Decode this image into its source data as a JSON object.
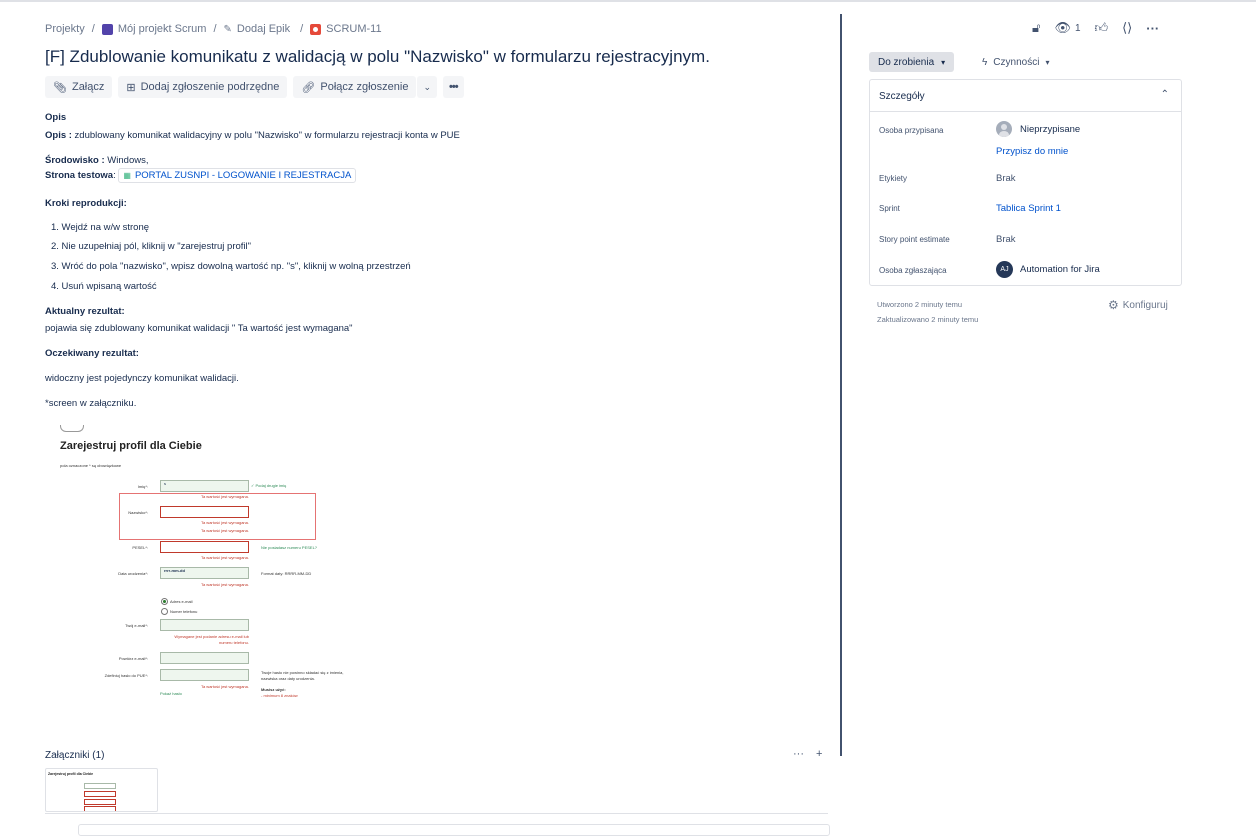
{
  "breadcrumb": {
    "projects": "Projekty",
    "project": "Mój projekt Scrum",
    "epic": "Dodaj Epik",
    "issue_key": "SCRUM-11"
  },
  "issue": {
    "title": "[F] Zdublowanie komunikatu z walidacją w polu \"Nazwisko\" w formularzu rejestracyjnym."
  },
  "toolbar": {
    "attach": "Załącz",
    "add_child": "Dodaj zgłoszenie podrzędne",
    "link_issue": "Połącz zgłoszenie",
    "more": "•••"
  },
  "description": {
    "heading": "Opis",
    "opis_label": "Opis :",
    "opis_text": " zdublowany komunikat walidacyjny w polu \"Nazwisko\" w formularzu rejestracji konta w PUE",
    "env_label": "Środowisko :",
    "env_text": " Windows,",
    "page_label": "Strona testowa",
    "page_link": "PORTAL ZUSNPI - LOGOWANIE I REJESTRACJA",
    "steps_heading": "Kroki reprodukcji:",
    "steps": [
      "1. Wejdź na w/w stronę",
      "2. Nie uzupełniaj pól, kliknij w \"zarejestruj profil\"",
      "3. Wróć do pola \"nazwisko\", wpisz dowolną wartość np. \"s\", kliknij w wolną przestrzeń",
      "4. Usuń wpisaną wartość"
    ],
    "actual_heading": "Aktualny rezultat:",
    "actual_text": "pojawia się zdublowany komunikat walidacji \" Ta wartość jest wymagana\"",
    "expected_heading": "Oczekiwany rezultat:",
    "expected_text": "widoczny jest pojedynczy komunikat walidacji.",
    "screen_note": "*screen w załączniku."
  },
  "screenshot": {
    "title": "Zarejestruj profil dla Ciebie",
    "note": "pola oznaczone * są obowiązkowe",
    "imie": "Imię*:",
    "imie_value": "s",
    "imie_hint": "✓ Podaj drugie imię",
    "req": "Ta wartość jest wymagana.",
    "nazwisko": "Nazwisko*:",
    "pesel": "PESEL*:",
    "pesel_hint": "Nie posiadasz numeru PESEL?",
    "dob": "Data urodzenia*:",
    "dob_value": "rrrr-mm-dd",
    "dob_hint": "Format daty: RRRR-MM-DD",
    "radio_email": "Adres e-mail",
    "radio_phone": "Numer telefonu",
    "email": "Twój e-mail*:",
    "email_err1": "Wymagane jest podanie adresu e-mail lub",
    "email_err2": "numeru telefonu.",
    "email_repeat": "Powtórz e-mail*:",
    "password": "Zdefiniuj hasło do PUE*:",
    "show_password": "Pokaż hasło",
    "pw_hint1": "Twoje hasło nie powinno składać się z imienia,",
    "pw_hint2": "nazwiska oraz daty urodzenia.",
    "pw_must": "Musisz użyć:",
    "pw_rule": "- minimum 8 znaków",
    "thumb_title": "Zarejestruj profil dla Ciebie"
  },
  "attachments": {
    "title": "Załączniki (1)",
    "more": "···",
    "add": "+"
  },
  "header_actions": {
    "watch_count": "1"
  },
  "status": {
    "label": "Do zrobienia",
    "actions": "Czynności"
  },
  "details": {
    "heading": "Szczegóły",
    "assignee_label": "Osoba przypisana",
    "assignee_value": "Nieprzypisane",
    "assign_to_me": "Przypisz do mnie",
    "labels_label": "Etykiety",
    "labels_value": "Brak",
    "sprint_label": "Sprint",
    "sprint_value": "Tablica Sprint 1",
    "story_label": "Story point estimate",
    "story_value": "Brak",
    "reporter_label": "Osoba zgłaszająca",
    "reporter_initials": "AJ",
    "reporter_value": "Automation for Jira"
  },
  "meta": {
    "created": "Utworzono 2 minuty temu",
    "updated": "Zaktualizowano 2 minuty temu",
    "configure": "Konfiguruj"
  }
}
